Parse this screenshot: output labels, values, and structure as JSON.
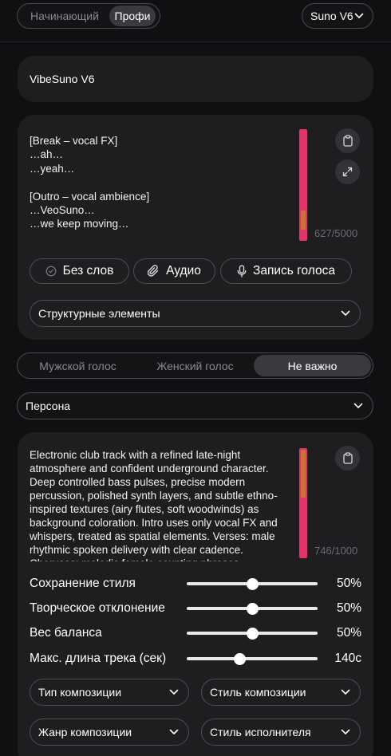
{
  "top": {
    "mode_options": [
      "Начинающий",
      "Профи"
    ],
    "model": "Suno V6"
  },
  "title_field": {
    "value": "VibeSuno V6"
  },
  "lyrics": {
    "text": "[Break – vocal FX]\n…ah…\n…yeah…\n\n[Outro – vocal ambience]\n…VeoSuno…\n…we keep moving…",
    "counter": "627/5000",
    "scroll_fraction": 0.89
  },
  "lyrics_buttons": {
    "no_words": "Без слов",
    "audio": "Аудио",
    "record": "Запись голоса"
  },
  "structure_select": {
    "value": "Структурные элементы"
  },
  "voice": {
    "options": [
      "Мужской голос",
      "Женский голос",
      "Не важно"
    ],
    "selected": "Не важно"
  },
  "persona_select": {
    "value": "Персона"
  },
  "style": {
    "text": "Electronic club track with a refined late-night atmosphere and confident underground character. Deep controlled bass pulses, precise modern percussion, polished synth layers, and subtle ethno-inspired textures (airy flutes, soft woodwinds) as background coloration. Intro uses only vocal FX and whispers, treated as spatial elements. Verses: male rhythmic spoken delivery with clear cadence. Choruses: melodic female counting phrases",
    "counter": "746/1000"
  },
  "sliders": [
    {
      "label": "Сохранение стиля",
      "value_text": "50%",
      "fraction": 0.5
    },
    {
      "label": "Творческое отклонение",
      "value_text": "50%",
      "fraction": 0.5
    },
    {
      "label": "Вес баланса",
      "value_text": "50%",
      "fraction": 0.5
    },
    {
      "label": "Макс. длина трека (сек)",
      "value_text": "140с",
      "fraction": 0.4
    }
  ],
  "composition_selects": {
    "type": "Тип композиции",
    "style": "Стиль композиции",
    "genre": "Жанр композиции",
    "performer": "Стиль исполнителя"
  },
  "icons": {
    "copy": "clipboard-icon",
    "expand": "expand-icon",
    "no_words": "check-circle-icon",
    "audio": "paperclip-icon",
    "record": "microphone-icon",
    "select": "chevron-down-icon"
  },
  "colors": {
    "accent": "#e3356a",
    "scroll_thumb": "#c8762f",
    "card": "#1e1e21",
    "background": "#101012"
  }
}
